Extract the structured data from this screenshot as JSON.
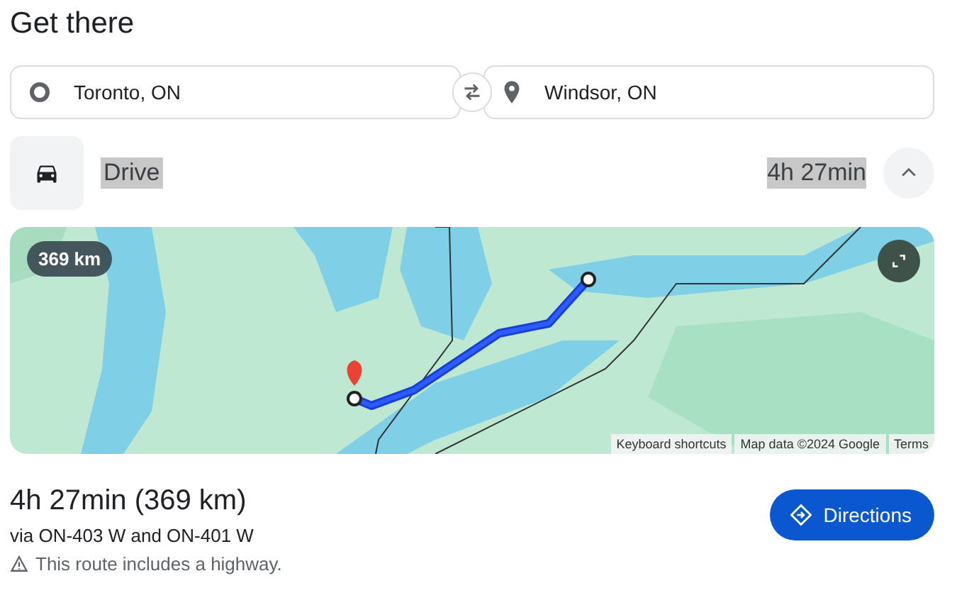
{
  "title": "Get there",
  "origin": {
    "value": "Toronto, ON"
  },
  "destination": {
    "value": "Windsor, ON"
  },
  "mode": {
    "kind": "drive",
    "label": "Drive",
    "duration": "4h 27min",
    "text_highlighted": true,
    "expanded": true
  },
  "map": {
    "kind": "picture",
    "distance_badge": "369 km",
    "footer": [
      "Keyboard shortcuts",
      "Map data ©2024 Google",
      "Terms"
    ]
  },
  "summary": {
    "headline": "4h 27min (369 km)",
    "via": "via ON-403 W and ON-401 W",
    "warning": "This route includes a highway."
  },
  "buttons": [
    {
      "label": "Directions"
    }
  ]
}
